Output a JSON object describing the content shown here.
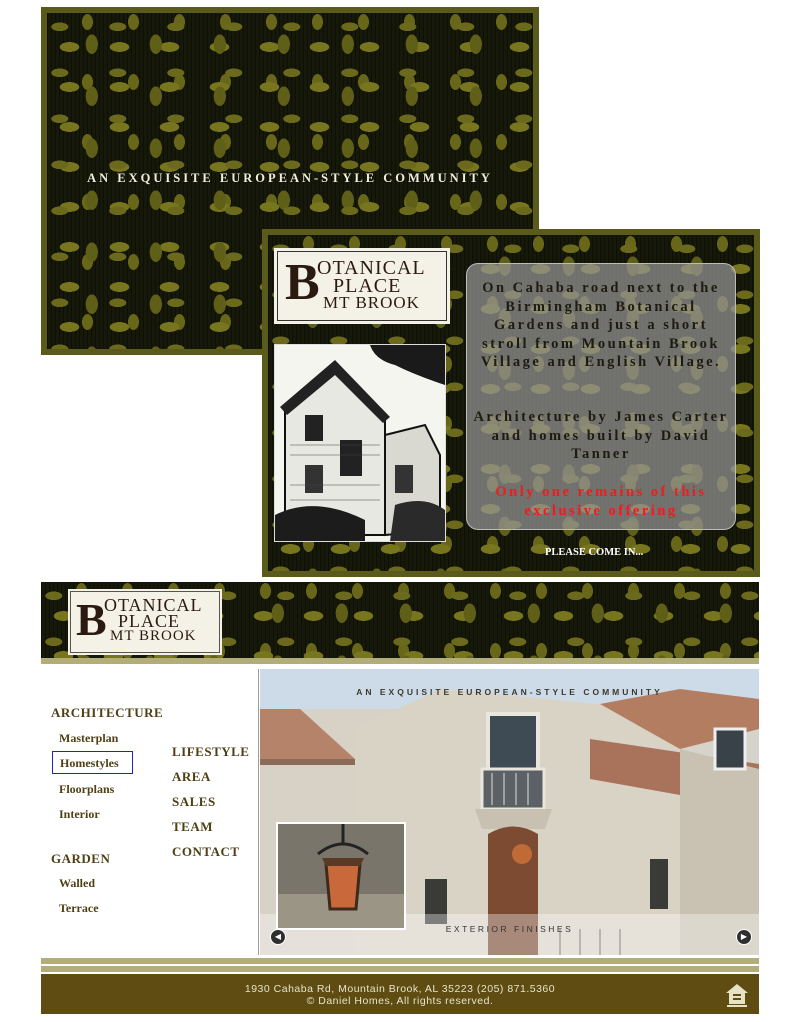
{
  "splash": {
    "tagline": "AN EXQUISITE EUROPEAN-STYLE COMMUNITY",
    "logo": {
      "big_letter": "B",
      "line1": "OTANICAL",
      "line2": "PLACE",
      "line3": "MT BROOK"
    },
    "description1": "On Cahaba road next to the Birmingham Botanical Gardens and just a short stroll from Mountain Brook Village and English Village.",
    "description2": "Architecture by James Carter and homes built by David Tanner",
    "offer": "Only one remains of this exclusive offering",
    "enter_link": "PLEASE COME IN..."
  },
  "site": {
    "logo": {
      "big_letter": "B",
      "line1": "OTANICAL",
      "line2": "PLACE",
      "line3": "MT BROOK"
    },
    "nav": {
      "architecture": {
        "heading": "ARCHITECTURE",
        "items": [
          "Masterplan",
          "Homestyles",
          "Floorplans",
          "Interior"
        ]
      },
      "garden": {
        "heading": "GARDEN",
        "items": [
          "Walled",
          "Terrace"
        ]
      },
      "main": [
        "LIFESTYLE",
        "AREA",
        "SALES",
        "TEAM",
        "CONTACT"
      ],
      "selected": "Homestyles"
    },
    "hero": {
      "tagline": "AN EXQUISITE EUROPEAN-STYLE COMMUNITY",
      "caption": "EXTERIOR FINISHES",
      "prev_icon": "arrow-left-icon",
      "next_icon": "arrow-right-icon"
    },
    "footer": {
      "address": "1930 Cahaba Rd,  Mountain Brook, AL 35223   (205) 871.5360",
      "copyright": "© Daniel Homes, All rights reserved.",
      "icon": "equal-housing-icon"
    }
  },
  "colors": {
    "olive": "#5a5a1a",
    "footer_brown": "#5e4c13",
    "nav_text": "#4e3f14",
    "offer_red": "#ee1c1c"
  }
}
